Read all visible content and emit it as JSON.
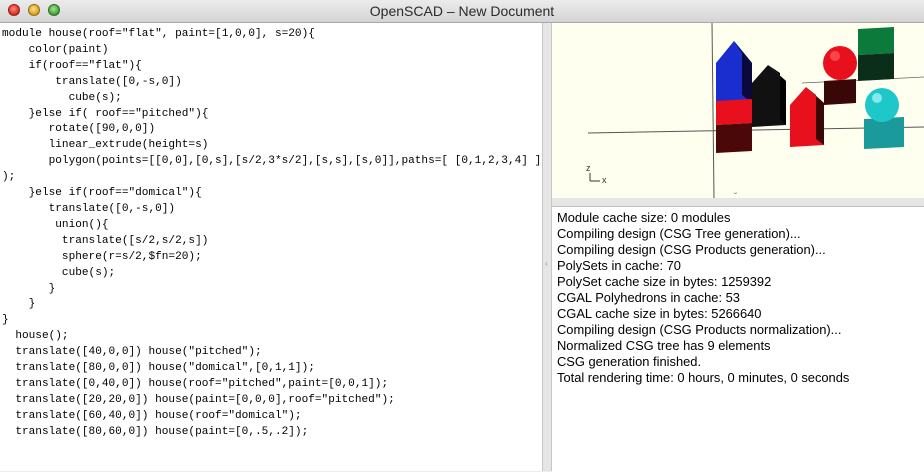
{
  "window": {
    "title": "OpenSCAD – New Document"
  },
  "editor": {
    "lines": [
      "module house(roof=\"flat\", paint=[1,0,0], s=20){",
      "    color(paint)",
      "    if(roof==\"flat\"){",
      "        translate([0,-s,0])",
      "          cube(s);",
      "    }else if( roof==\"pitched\"){",
      "       rotate([90,0,0])",
      "       linear_extrude(height=s)",
      "       polygon(points=[[0,0],[0,s],[s/2,3*s/2],[s,s],[s,0]],paths=[ [0,1,2,3,4] ]",
      ");",
      "    }else if(roof==\"domical\"){",
      "       translate([0,-s,0])",
      "        union(){",
      "         translate([s/2,s/2,s])",
      "         sphere(r=s/2,$fn=20);",
      "         cube(s);",
      "       }",
      "    }",
      "}",
      "",
      "  house();",
      "  translate([40,0,0]) house(\"pitched\");",
      "  translate([80,0,0]) house(\"domical\",[0,1,1]);",
      "  translate([0,40,0]) house(roof=\"pitched\",paint=[0,0,1]);",
      "  translate([20,20,0]) house(paint=[0,0,0],roof=\"pitched\");",
      "  translate([60,40,0]) house(roof=\"domical\");",
      "  translate([80,60,0]) house(paint=[0,.5,.2]);"
    ]
  },
  "viewport": {
    "axis_labels": {
      "z": "z",
      "x": "x"
    },
    "colors": {
      "background": "#fffff0",
      "red": "#e8101c",
      "blue": "#1a2ecf",
      "black": "#111111",
      "cyan": "#1ec8c8",
      "green": "#0b7a3a"
    }
  },
  "console": {
    "lines": [
      "Module cache size: 0 modules",
      "Compiling design (CSG Tree generation)...",
      "Compiling design (CSG Products generation)...",
      "PolySets in cache: 70",
      "PolySet cache size in bytes: 1259392",
      "CGAL Polyhedrons in cache: 53",
      "CGAL cache size in bytes: 5266640",
      "Compiling design (CSG Products normalization)...",
      "Normalized CSG tree has 9 elements",
      "CSG generation finished.",
      "Total rendering time: 0 hours, 0 minutes, 0 seconds"
    ]
  }
}
